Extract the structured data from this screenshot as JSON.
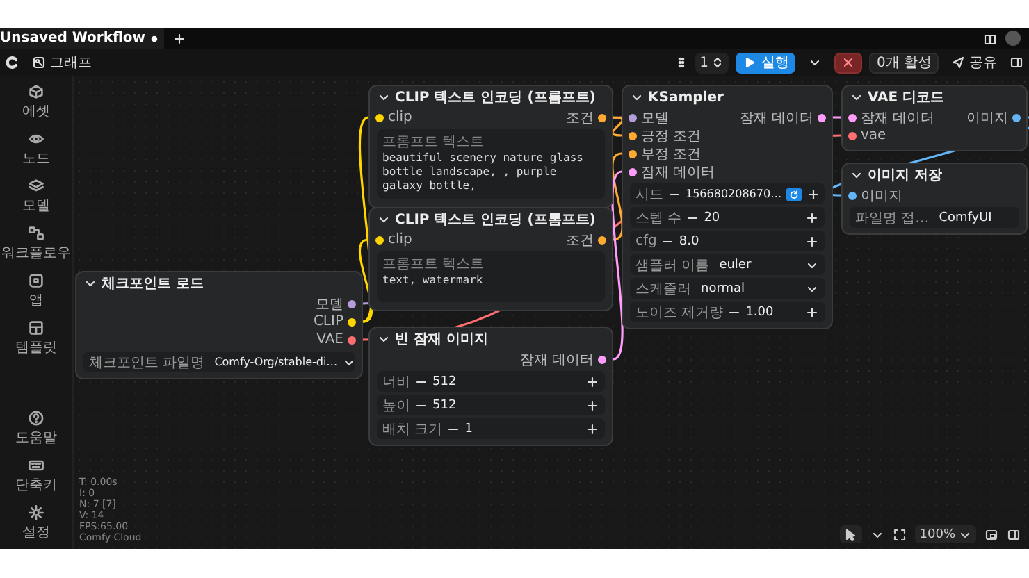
{
  "tab": {
    "title": "Unsaved Workflow",
    "unsaved": true
  },
  "toolbar": {
    "graph_menu": "그래프",
    "batch_count": "1",
    "run_button": "실행",
    "active_jobs": "0개 활성",
    "share_button": "공유"
  },
  "sidebar": {
    "items": [
      {
        "label": "에셋"
      },
      {
        "label": "노드"
      },
      {
        "label": "모델"
      },
      {
        "label": "워크플로우"
      },
      {
        "label": "앱"
      },
      {
        "label": "템플릿"
      }
    ],
    "bottom_items": [
      {
        "label": "도움말"
      },
      {
        "label": "단축키"
      },
      {
        "label": "설정"
      }
    ]
  },
  "stats": [
    "T: 0.00s",
    "I: 0",
    "N: 7 [7]",
    "V: 14",
    "FPS:65.00",
    "Comfy Cloud"
  ],
  "nodes": [
    {
      "title": "CLIP 텍스트 인코딩 (프롬프트)",
      "inputs": [
        {
          "label": "clip",
          "color": "#ffd500"
        }
      ],
      "outputs": [
        {
          "label": "조건",
          "color": "#ffa931"
        }
      ],
      "prompt": {
        "label": "프롬프트 텍스트",
        "text": "beautiful scenery nature glass bottle landscape, , purple galaxy bottle,"
      }
    },
    {
      "title": "CLIP 텍스트 인코딩 (프롬프트)",
      "inputs": [
        {
          "label": "clip",
          "color": "#ffd500"
        }
      ],
      "outputs": [
        {
          "label": "조건",
          "color": "#ffa931"
        }
      ],
      "prompt": {
        "label": "프롬프트 텍스트",
        "text": "text, watermark"
      }
    },
    {
      "title": "체크포인트 로드",
      "outputs": [
        {
          "label": "모델",
          "color": "#b39ddb"
        },
        {
          "label": "CLIP",
          "color": "#ffd500"
        },
        {
          "label": "VAE",
          "color": "#ff6e6e"
        }
      ],
      "widgets": [
        {
          "kind": "combo",
          "label": "체크포인트 파일명",
          "value": "Comfy-Org/stable-di…"
        }
      ]
    },
    {
      "title": "KSampler",
      "inputs": [
        {
          "label": "모델",
          "color": "#b39ddb"
        },
        {
          "label": "긍정 조건",
          "color": "#ffa931"
        },
        {
          "label": "부정 조건",
          "color": "#ffa931"
        },
        {
          "label": "잠재 데이터",
          "color": "#ff9cf9"
        }
      ],
      "outputs": [
        {
          "label": "잠재 데이터",
          "color": "#ff9cf9"
        }
      ],
      "widgets": [
        {
          "kind": "seed",
          "label": "시드",
          "value": "156680208670…"
        },
        {
          "kind": "number",
          "label": "스텝 수",
          "value": "20"
        },
        {
          "kind": "number",
          "label": "cfg",
          "value": "8.0"
        },
        {
          "kind": "combo",
          "label": "샘플러 이름",
          "value": "euler"
        },
        {
          "kind": "combo",
          "label": "스케줄러",
          "value": "normal"
        },
        {
          "kind": "number",
          "label": "노이즈 제거량",
          "value": "1.00"
        }
      ]
    },
    {
      "title": "VAE 디코드",
      "inputs": [
        {
          "label": "잠재 데이터",
          "color": "#ff9cf9"
        },
        {
          "label": "vae",
          "color": "#ff6e6e"
        }
      ],
      "outputs": [
        {
          "label": "이미지",
          "color": "#64b5f6"
        }
      ]
    },
    {
      "title": "이미지 저장",
      "inputs": [
        {
          "label": "이미지",
          "color": "#64b5f6"
        }
      ],
      "widgets": [
        {
          "kind": "text",
          "label": "파일명 접…",
          "value": "ComfyUI"
        }
      ]
    },
    {
      "title": "빈 잠재 이미지",
      "outputs": [
        {
          "label": "잠재 데이터",
          "color": "#ff9cf9"
        }
      ],
      "widgets": [
        {
          "kind": "number",
          "label": "너비",
          "value": "512"
        },
        {
          "kind": "number",
          "label": "높이",
          "value": "512"
        },
        {
          "kind": "number",
          "label": "배치 크기",
          "value": "1"
        }
      ]
    }
  ],
  "zoom": "100%"
}
